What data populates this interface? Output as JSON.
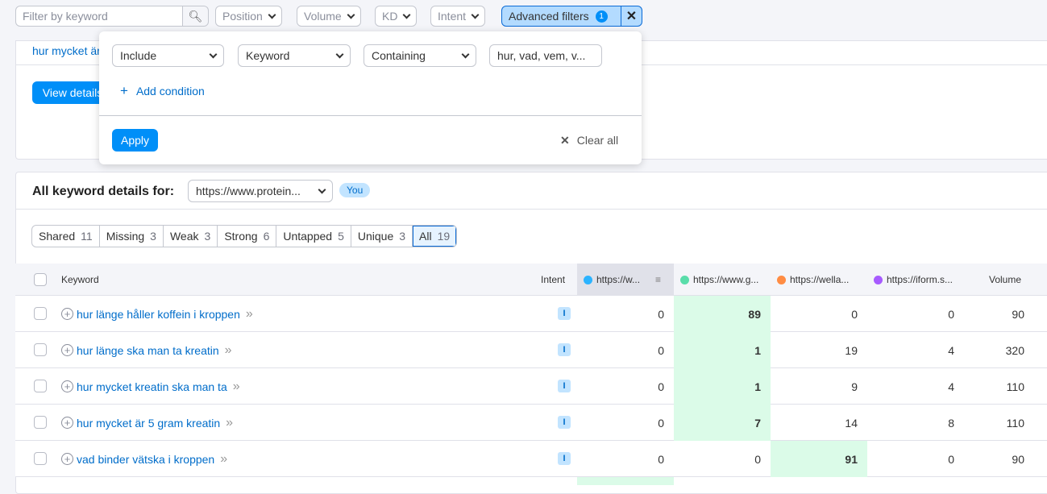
{
  "filters": {
    "search_placeholder": "Filter by keyword",
    "position": "Position",
    "volume": "Volume",
    "kd": "KD",
    "intent": "Intent",
    "advanced": "Advanced filters",
    "advanced_count": "1"
  },
  "popup": {
    "include": "Include",
    "keyword": "Keyword",
    "containing": "Containing",
    "value": "hur, vad, vem, v...",
    "add_condition": "Add condition",
    "apply": "Apply",
    "clear_all": "Clear all"
  },
  "top_card": {
    "link": "hur mycket är",
    "view_details": "View details"
  },
  "details": {
    "title": "All keyword details for:",
    "domain": "https://www.protein...",
    "badge": "You"
  },
  "segments": [
    {
      "label": "Shared",
      "count": "11"
    },
    {
      "label": "Missing",
      "count": "3"
    },
    {
      "label": "Weak",
      "count": "3"
    },
    {
      "label": "Strong",
      "count": "6"
    },
    {
      "label": "Untapped",
      "count": "5"
    },
    {
      "label": "Unique",
      "count": "3"
    },
    {
      "label": "All",
      "count": "19"
    }
  ],
  "columns": {
    "keyword": "Keyword",
    "intent": "Intent",
    "d1": "https://w...",
    "d2": "https://www.g...",
    "d3": "https://wella...",
    "d4": "https://iform.s...",
    "volume": "Volume"
  },
  "colors": {
    "d1": "#2bb3ff",
    "d2": "#59ddaa",
    "d3": "#ff8c43",
    "d4": "#a75bff",
    "accent": "#008ff8",
    "highlight": "#dbfbe8"
  },
  "rows": [
    {
      "keyword": "hur länge håller koffein i kroppen",
      "intent": "I",
      "d1": "0",
      "d2": "89",
      "d3": "0",
      "d4": "0",
      "volume": "90",
      "best": "d2"
    },
    {
      "keyword": "hur länge ska man ta kreatin",
      "intent": "I",
      "d1": "0",
      "d2": "1",
      "d3": "19",
      "d4": "4",
      "volume": "320",
      "best": "d2"
    },
    {
      "keyword": "hur mycket kreatin ska man ta",
      "intent": "I",
      "d1": "0",
      "d2": "1",
      "d3": "9",
      "d4": "4",
      "volume": "110",
      "best": "d2"
    },
    {
      "keyword": "hur mycket är 5 gram kreatin",
      "intent": "I",
      "d1": "0",
      "d2": "7",
      "d3": "14",
      "d4": "8",
      "volume": "110",
      "best": "d2"
    },
    {
      "keyword": "vad binder vätska i kroppen",
      "intent": "I",
      "d1": "0",
      "d2": "0",
      "d3": "91",
      "d4": "0",
      "volume": "90",
      "best": "d3"
    }
  ]
}
